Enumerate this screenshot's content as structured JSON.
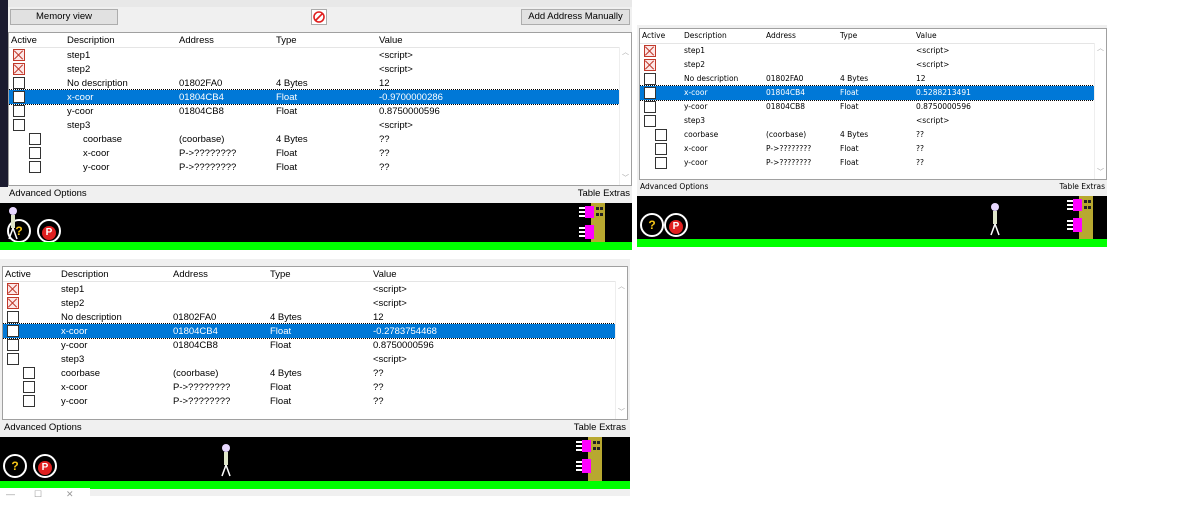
{
  "toolbar": {
    "memory_view_label": "Memory view",
    "add_address_label": "Add Address Manually"
  },
  "columns": [
    "Active",
    "Description",
    "Address",
    "Type",
    "Value"
  ],
  "footer": {
    "advanced": "Advanced Options",
    "extras": "Table Extras"
  },
  "colors": {
    "selection": "#0078d7",
    "ground": "#00ff00",
    "game_bg": "#000000",
    "block_magenta": "#ff00ff",
    "block_olive": "#b8a830"
  },
  "game": {
    "help_glyph": "?",
    "pause_glyph": "P"
  },
  "table1": {
    "rows": [
      {
        "checked": true,
        "desc": "step1",
        "addr": "",
        "type": "",
        "value": "<script>"
      },
      {
        "checked": true,
        "desc": "step2",
        "addr": "",
        "type": "",
        "value": "<script>"
      },
      {
        "checked": false,
        "desc": "No description",
        "addr": "01802FA0",
        "type": "4 Bytes",
        "value": "12"
      },
      {
        "checked": false,
        "desc": "x-coor",
        "addr": "01804CB4",
        "type": "Float",
        "value": "-0.9700000286"
      },
      {
        "checked": false,
        "desc": "y-coor",
        "addr": "01804CB8",
        "type": "Float",
        "value": "0.8750000596"
      },
      {
        "checked": false,
        "desc": "step3",
        "addr": "",
        "type": "",
        "value": "<script>"
      },
      {
        "checked": false,
        "desc": "coorbase",
        "addr": "(coorbase)",
        "type": "4 Bytes",
        "value": "??"
      },
      {
        "checked": false,
        "desc": "x-coor",
        "addr": "P->????????",
        "type": "Float",
        "value": "??"
      },
      {
        "checked": false,
        "desc": "y-coor",
        "addr": "P->????????",
        "type": "Float",
        "value": "??"
      }
    ]
  },
  "table2": {
    "rows": [
      {
        "checked": true,
        "desc": "step1",
        "addr": "",
        "type": "",
        "value": "<script>"
      },
      {
        "checked": true,
        "desc": "step2",
        "addr": "",
        "type": "",
        "value": "<script>"
      },
      {
        "checked": false,
        "desc": "No description",
        "addr": "01802FA0",
        "type": "4 Bytes",
        "value": "12"
      },
      {
        "checked": false,
        "desc": "x-coor",
        "addr": "01804CB4",
        "type": "Float",
        "value": "0.5288213491"
      },
      {
        "checked": false,
        "desc": "y-coor",
        "addr": "01804CB8",
        "type": "Float",
        "value": "0.8750000596"
      },
      {
        "checked": false,
        "desc": "step3",
        "addr": "",
        "type": "",
        "value": "<script>"
      },
      {
        "checked": false,
        "desc": "coorbase",
        "addr": "(coorbase)",
        "type": "4 Bytes",
        "value": "??"
      },
      {
        "checked": false,
        "desc": "x-coor",
        "addr": "P->????????",
        "type": "Float",
        "value": "??"
      },
      {
        "checked": false,
        "desc": "y-coor",
        "addr": "P->????????",
        "type": "Float",
        "value": "??"
      }
    ]
  },
  "table3": {
    "rows": [
      {
        "checked": true,
        "desc": "step1",
        "addr": "",
        "type": "",
        "value": "<script>"
      },
      {
        "checked": true,
        "desc": "step2",
        "addr": "",
        "type": "",
        "value": "<script>"
      },
      {
        "checked": false,
        "desc": "No description",
        "addr": "01802FA0",
        "type": "4 Bytes",
        "value": "12"
      },
      {
        "checked": false,
        "desc": "x-coor",
        "addr": "01804CB4",
        "type": "Float",
        "value": "-0.2783754468"
      },
      {
        "checked": false,
        "desc": "y-coor",
        "addr": "01804CB8",
        "type": "Float",
        "value": "0.8750000596"
      },
      {
        "checked": false,
        "desc": "step3",
        "addr": "",
        "type": "",
        "value": "<script>"
      },
      {
        "checked": false,
        "desc": "coorbase",
        "addr": "(coorbase)",
        "type": "4 Bytes",
        "value": "??"
      },
      {
        "checked": false,
        "desc": "x-coor",
        "addr": "P->????????",
        "type": "Float",
        "value": "??"
      },
      {
        "checked": false,
        "desc": "y-coor",
        "addr": "P->????????",
        "type": "Float",
        "value": "??"
      }
    ]
  }
}
